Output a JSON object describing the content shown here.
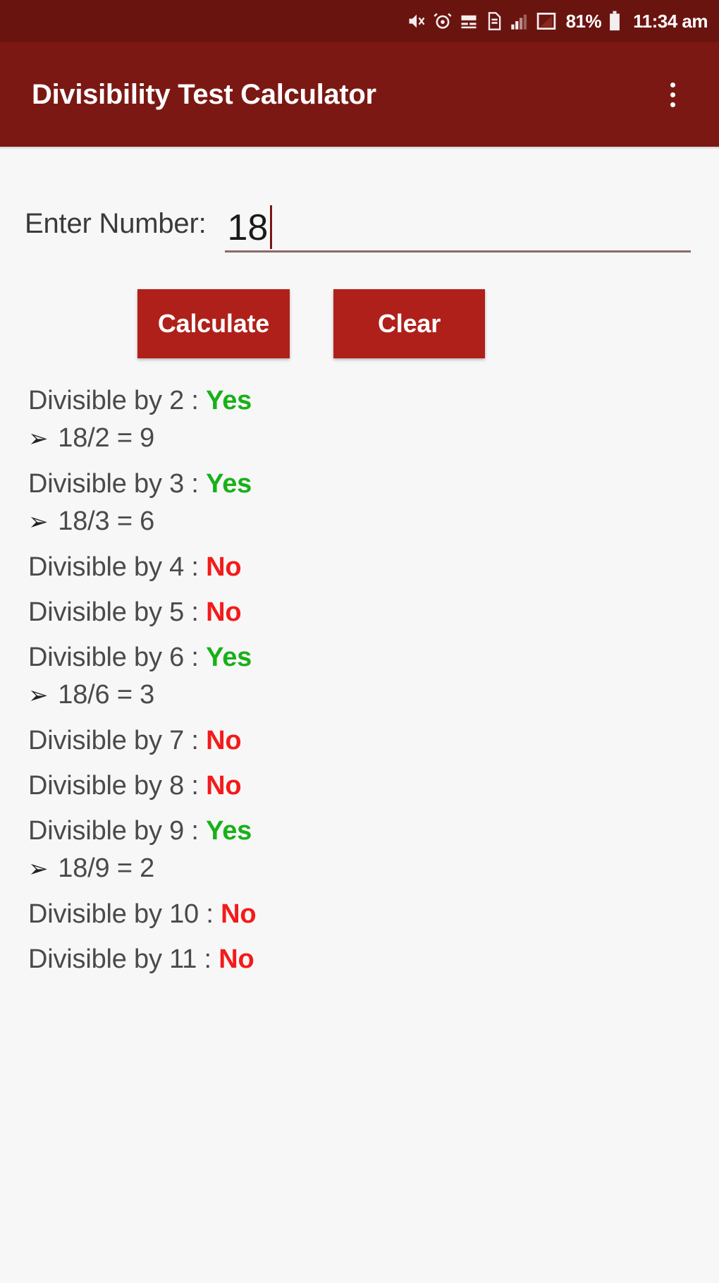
{
  "status_bar": {
    "icons": [
      "mute-icon",
      "alarm-icon",
      "wifi-calling-icon",
      "sd-card-icon",
      "signal-bars-icon",
      "network-icon"
    ],
    "battery_percent": "81%",
    "battery_icon": "battery-icon",
    "clock": "11:34 am"
  },
  "toolbar": {
    "title": "Divisibility Test Calculator",
    "overflow_icon": "overflow-menu-icon",
    "background_color": "#7b1813"
  },
  "form": {
    "label": "Enter Number:",
    "value": "18",
    "placeholder": "",
    "calculate_label": "Calculate",
    "clear_label": "Clear",
    "button_color": "#b0201a"
  },
  "colors": {
    "yes": "#19b019",
    "no": "#f51a1a",
    "accent": "#7b1813",
    "background": "#f7f7f7"
  },
  "results": {
    "arrow": "➢",
    "items": [
      {
        "label": "Divisible by 2 :",
        "verdict": "Yes",
        "divisible": true,
        "detail": "18/2 = 9"
      },
      {
        "label": "Divisible by 3 :",
        "verdict": "Yes",
        "divisible": true,
        "detail": "18/3 = 6"
      },
      {
        "label": "Divisible by 4 :",
        "verdict": "No",
        "divisible": false,
        "detail": ""
      },
      {
        "label": "Divisible by 5 :",
        "verdict": "No",
        "divisible": false,
        "detail": ""
      },
      {
        "label": "Divisible by 6 :",
        "verdict": "Yes",
        "divisible": true,
        "detail": "18/6 = 3"
      },
      {
        "label": "Divisible by 7 :",
        "verdict": "No",
        "divisible": false,
        "detail": ""
      },
      {
        "label": "Divisible by 8 :",
        "verdict": "No",
        "divisible": false,
        "detail": ""
      },
      {
        "label": "Divisible by 9 :",
        "verdict": "Yes",
        "divisible": true,
        "detail": "18/9 = 2"
      },
      {
        "label": "Divisible by 10 :",
        "verdict": "No",
        "divisible": false,
        "detail": ""
      },
      {
        "label": "Divisible by 11 :",
        "verdict": "No",
        "divisible": false,
        "detail": ""
      }
    ]
  }
}
